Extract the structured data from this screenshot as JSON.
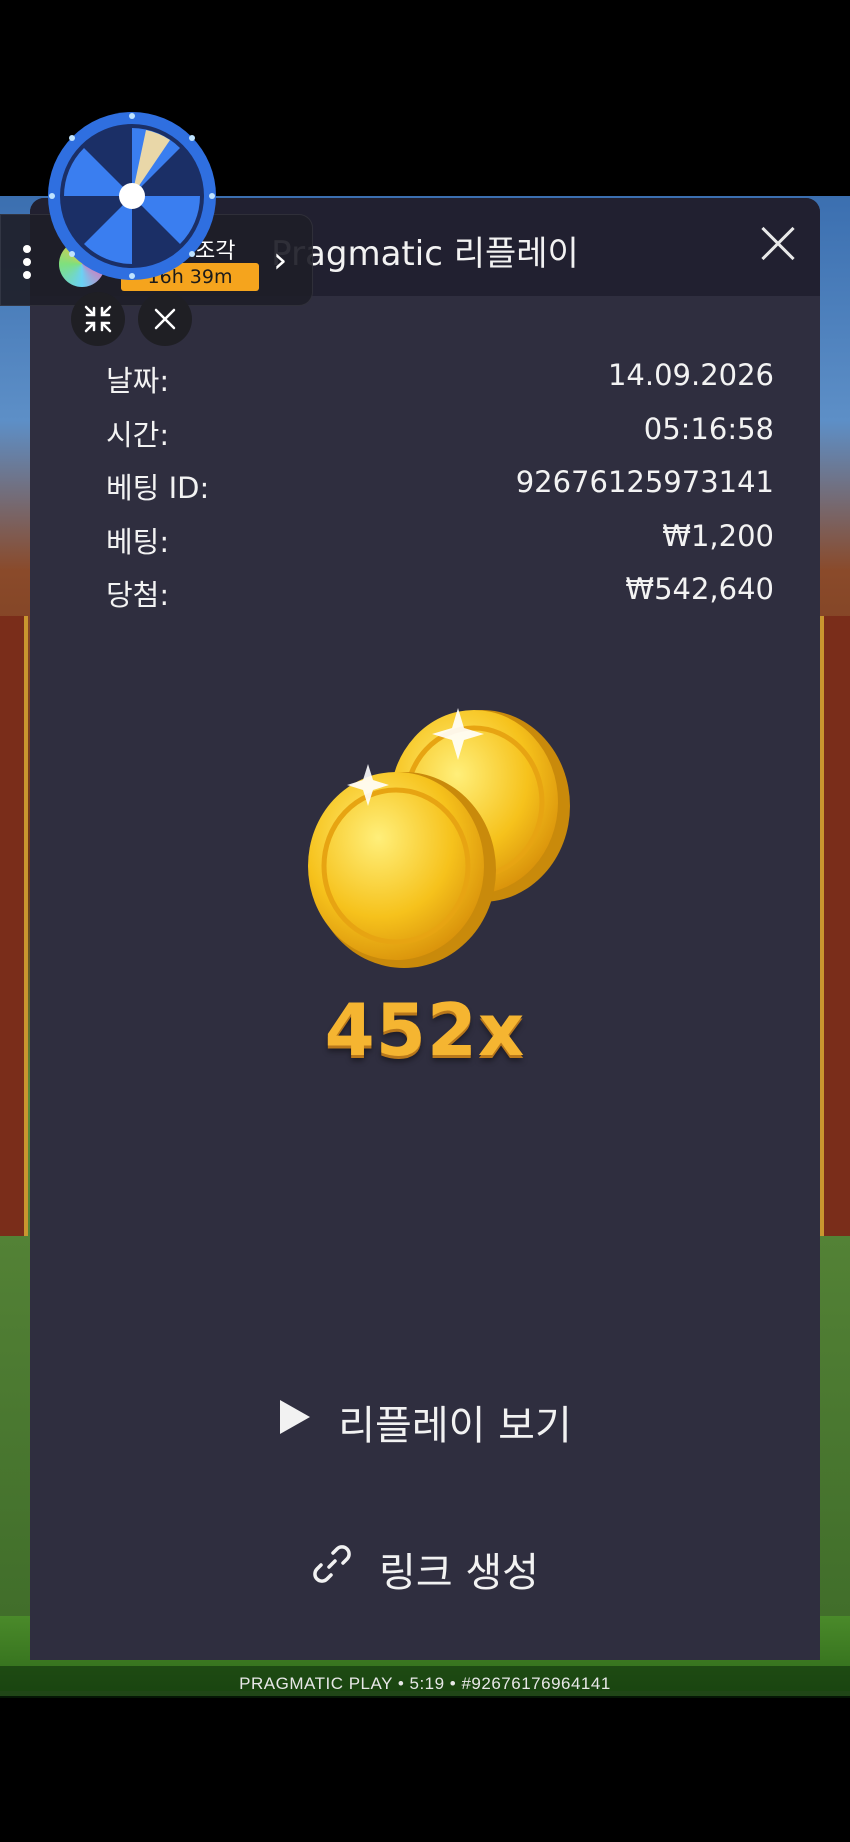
{
  "modal": {
    "title": "Pragmatic 리플레이",
    "close_label": "close",
    "rows": [
      {
        "label": "날짜:",
        "value": "14.09.2026"
      },
      {
        "label": "시간:",
        "value": "05:16:58"
      },
      {
        "label": "베팅 ID:",
        "value": "92676125973141"
      },
      {
        "label": "베팅:",
        "value": "₩1,200"
      },
      {
        "label": "당첨:",
        "value": "₩542,640"
      }
    ],
    "multiplier": "452x",
    "replay_label": "리플레이 보기",
    "link_label": "링크 생성"
  },
  "overlay": {
    "name_suffix": "조각",
    "timer": "16h 39m"
  },
  "footer": {
    "text": "PRAGMATIC PLAY • 5:19 • #92676176964141"
  },
  "colors": {
    "modal_bg": "#2f2e3f",
    "header_bg": "#212030",
    "multiplier": "#f5b531",
    "timer_badge": "#f5a41d"
  },
  "icons": [
    "close-icon",
    "play-icon",
    "link-icon",
    "dots-icon",
    "chevron-right-icon",
    "shrink-icon",
    "wheel-icon",
    "coins-icon"
  ]
}
